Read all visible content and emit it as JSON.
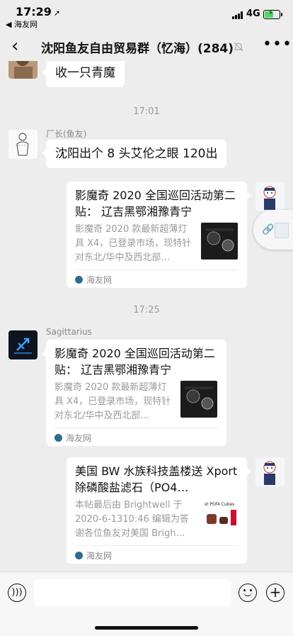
{
  "status_bar": {
    "time": "17:29",
    "back_app": "◀ 海友网",
    "network": "4G"
  },
  "nav": {
    "title": "沈阳鱼友自由贸易群（忆海）(284)"
  },
  "messages": [
    {
      "text": "收一只青魔"
    },
    {
      "timestamp": "17:01"
    },
    {
      "sender": "厂长(鱼友)",
      "text": "沈阳出个 8 头艾伦之眼 120出"
    },
    {
      "card": {
        "title": "影魔奇 2020 全国巡回活动第二贴： 辽吉黑鄂湘豫青宁",
        "desc": "影魔奇 2020 款最新超薄灯具 X4，已登录市场，现特针对东北/华中及西北部…",
        "source": "海友网"
      }
    },
    {
      "timestamp": "17:25"
    },
    {
      "sender": "Sagittarius",
      "card": {
        "title": "影魔奇 2020 全国巡回活动第二贴： 辽吉黑鄂湘豫青宁",
        "desc": "影魔奇 2020 款最新超薄灯具 X4，已登录市场，现特针对东北/华中及西北部…",
        "source": "海友网"
      }
    },
    {
      "card": {
        "title": "美国 BW 水族科技盖楼送 Xport 除磷酸盐滤石（PO4…",
        "desc": "本帖最后由 Brightwell 于 2020-6-1310:46 编辑为答谢各位鱼友对美国 Brigh…",
        "source": "海友网",
        "thumb_text": "xt POf4 Cubes"
      }
    }
  ],
  "colors": {
    "bg": "#ededed",
    "bubble": "#ffffff",
    "meta_text": "#9b9b9b"
  },
  "icons": [
    "back-icon",
    "mute-bell-icon",
    "more-icon",
    "voice-icon",
    "emoji-icon",
    "plus-icon",
    "link-icon"
  ]
}
